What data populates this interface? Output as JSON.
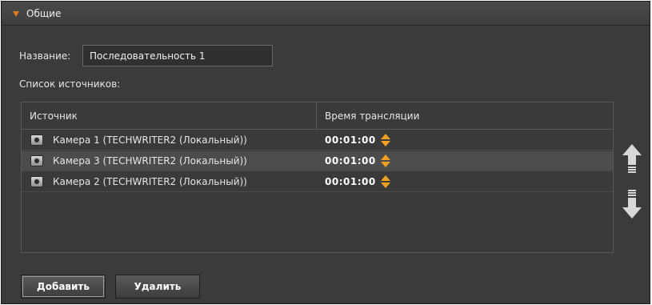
{
  "panel": {
    "title": "Общие"
  },
  "form": {
    "name_label": "Название:",
    "name_value": "Последовательность 1",
    "list_label": "Список источников:"
  },
  "table": {
    "columns": [
      "Источник",
      "Время трансляции"
    ],
    "rows": [
      {
        "source": "Камера 1 (TECHWRITER2 (Локальный))",
        "time": "00:01:00",
        "selected": false
      },
      {
        "source": "Камера 3 (TECHWRITER2 (Локальный))",
        "time": "00:01:00",
        "selected": true
      },
      {
        "source": "Камера 2 (TECHWRITER2 (Локальный))",
        "time": "00:01:00",
        "selected": false
      }
    ]
  },
  "side_buttons": {
    "up_icon": "arrow-up-icon",
    "down_icon": "arrow-down-icon"
  },
  "buttons": {
    "add_label": "Добавить",
    "delete_label": "Удалить"
  },
  "colors": {
    "accent": "#f0a020",
    "caret": "#e07a1a",
    "background": "#3b3b3b"
  }
}
